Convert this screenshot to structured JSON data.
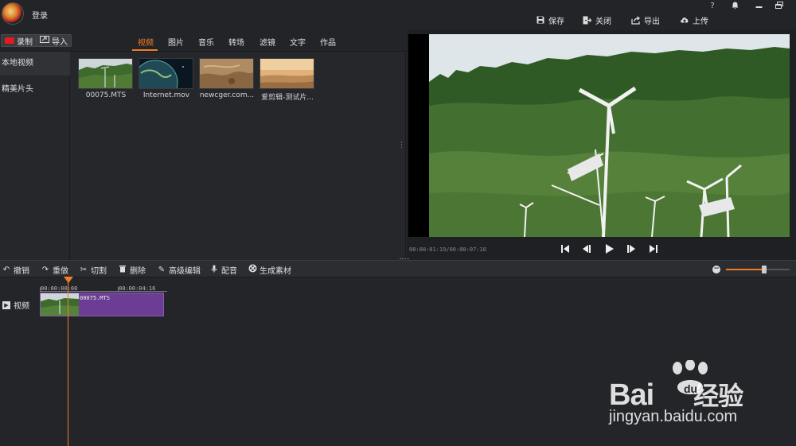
{
  "header": {
    "login_label": "登录",
    "help_label": "?",
    "actions": [
      {
        "label": "保存",
        "icon": "save-icon"
      },
      {
        "label": "关闭",
        "icon": "close-project-icon"
      },
      {
        "label": "导出",
        "icon": "export-icon"
      },
      {
        "label": "上传",
        "icon": "upload-icon"
      }
    ]
  },
  "media": {
    "record_label": "录制",
    "import_label": "导入",
    "tabs": [
      "视频",
      "图片",
      "音乐",
      "转场",
      "滤镜",
      "文字",
      "作品"
    ],
    "active_tab": "视频",
    "sidebar": [
      "本地视频",
      "精美片头"
    ],
    "items": [
      {
        "name": "00075.MTS"
      },
      {
        "name": "Internet.mov"
      },
      {
        "name": "newcger.com..."
      },
      {
        "name": "爱剪辑-测试片..."
      }
    ]
  },
  "preview": {
    "timecode": "00:00:01:19/00:00:07:10"
  },
  "toolbar": {
    "undo": "撤销",
    "redo": "重做",
    "cut": "切割",
    "delete": "删除",
    "advanced_edit": "高级编辑",
    "dub": "配音",
    "generate": "生成素材",
    "zoom_level": 0.6
  },
  "timeline": {
    "ticks": [
      "00:00:00:00",
      "00:00:04:16"
    ],
    "track_label": "视频",
    "clip_label": "00075.MTS"
  },
  "watermark": {
    "brand": "Bai",
    "brand_suffix": "经验",
    "url": "jingyan.baidu.com"
  },
  "colors": {
    "accent": "#f07c2a",
    "clip": "#6c3e93",
    "record": "#e31b1b"
  }
}
